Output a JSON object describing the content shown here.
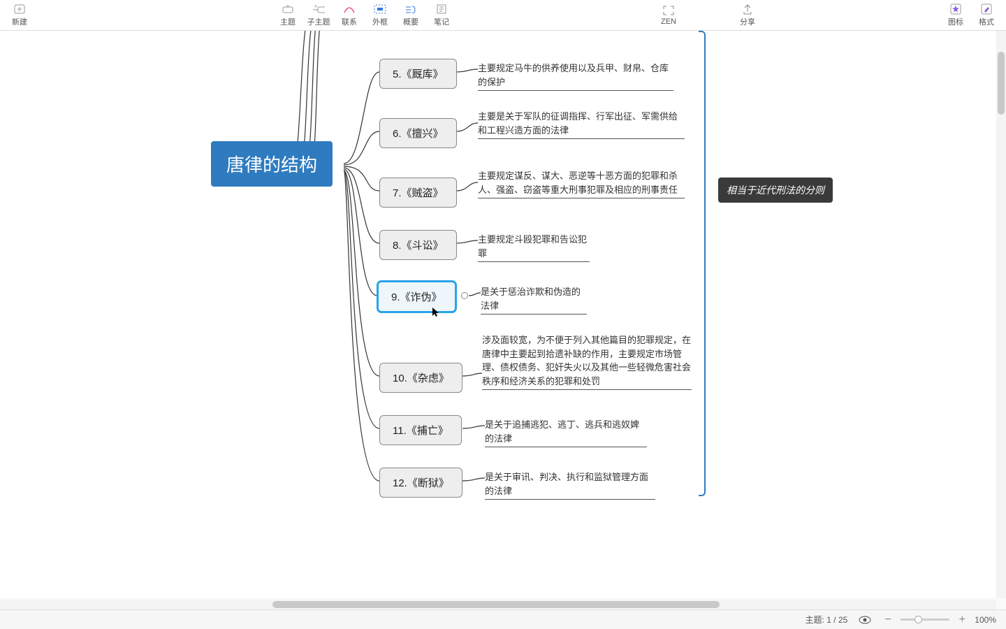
{
  "toolbar": {
    "new": "新建",
    "topic": "主题",
    "subtopic": "子主题",
    "relation": "联系",
    "boundary": "外框",
    "summary": "概要",
    "note": "笔记",
    "zen": "ZEN",
    "share": "分享",
    "icon": "图标",
    "format": "格式"
  },
  "central": "唐律的结构",
  "nodes": {
    "n5": "5.《厩库》",
    "n6": "6.《擅兴》",
    "n7": "7.《贼盗》",
    "n8": "8.《斗讼》",
    "n9": "9.《诈伪》",
    "n10": "10.《杂虑》",
    "n11": "11.《捕亡》",
    "n12": "12.《断狱》"
  },
  "notes": {
    "d5": "主要规定马牛的供养使用以及兵甲、财帛、仓库的保护",
    "d6": "主要是关于军队的征调指挥、行军出征、军需供给和工程兴造方面的法律",
    "d7": "主要规定谋反、谋大、恶逆等十恶方面的犯罪和杀人、强盗、窃盗等重大刑事犯罪及相应的刑事责任",
    "d8": "主要规定斗殴犯罪和告讼犯罪",
    "d9": "是关于惩治诈欺和伪造的法律",
    "d10": "涉及面较宽，为不便于列入其他篇目的犯罪规定，在唐律中主要起到拾遗补缺的作用，主要规定市场管理、债权债务、犯奸失火以及其他一些轻微危害社会秩序和经济关系的犯罪和处罚",
    "d11": "是关于追捕逃犯、逃丁、逃兵和逃奴婢的法律",
    "d12": "是关于审讯、判决、执行和监狱管理方面的法律"
  },
  "summary": "相当于近代刑法的分则",
  "status": {
    "topic_label": "主题: 1 / 25",
    "zoom": "100%"
  }
}
